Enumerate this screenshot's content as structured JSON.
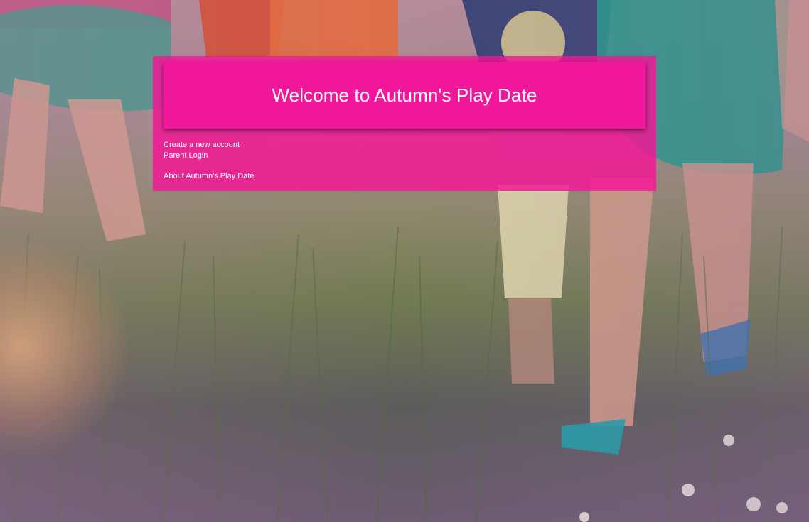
{
  "page": {
    "title": "Welcome to Autumn's Play Date"
  },
  "nav": {
    "create_account": "Create a new account",
    "parent_login": "Parent Login",
    "about": "About Autumn's Play Date"
  },
  "colors": {
    "accent": "#f0179a",
    "panel": "#f51496",
    "text": "#ffffff"
  },
  "background": {
    "image": "children running through grass photo"
  }
}
